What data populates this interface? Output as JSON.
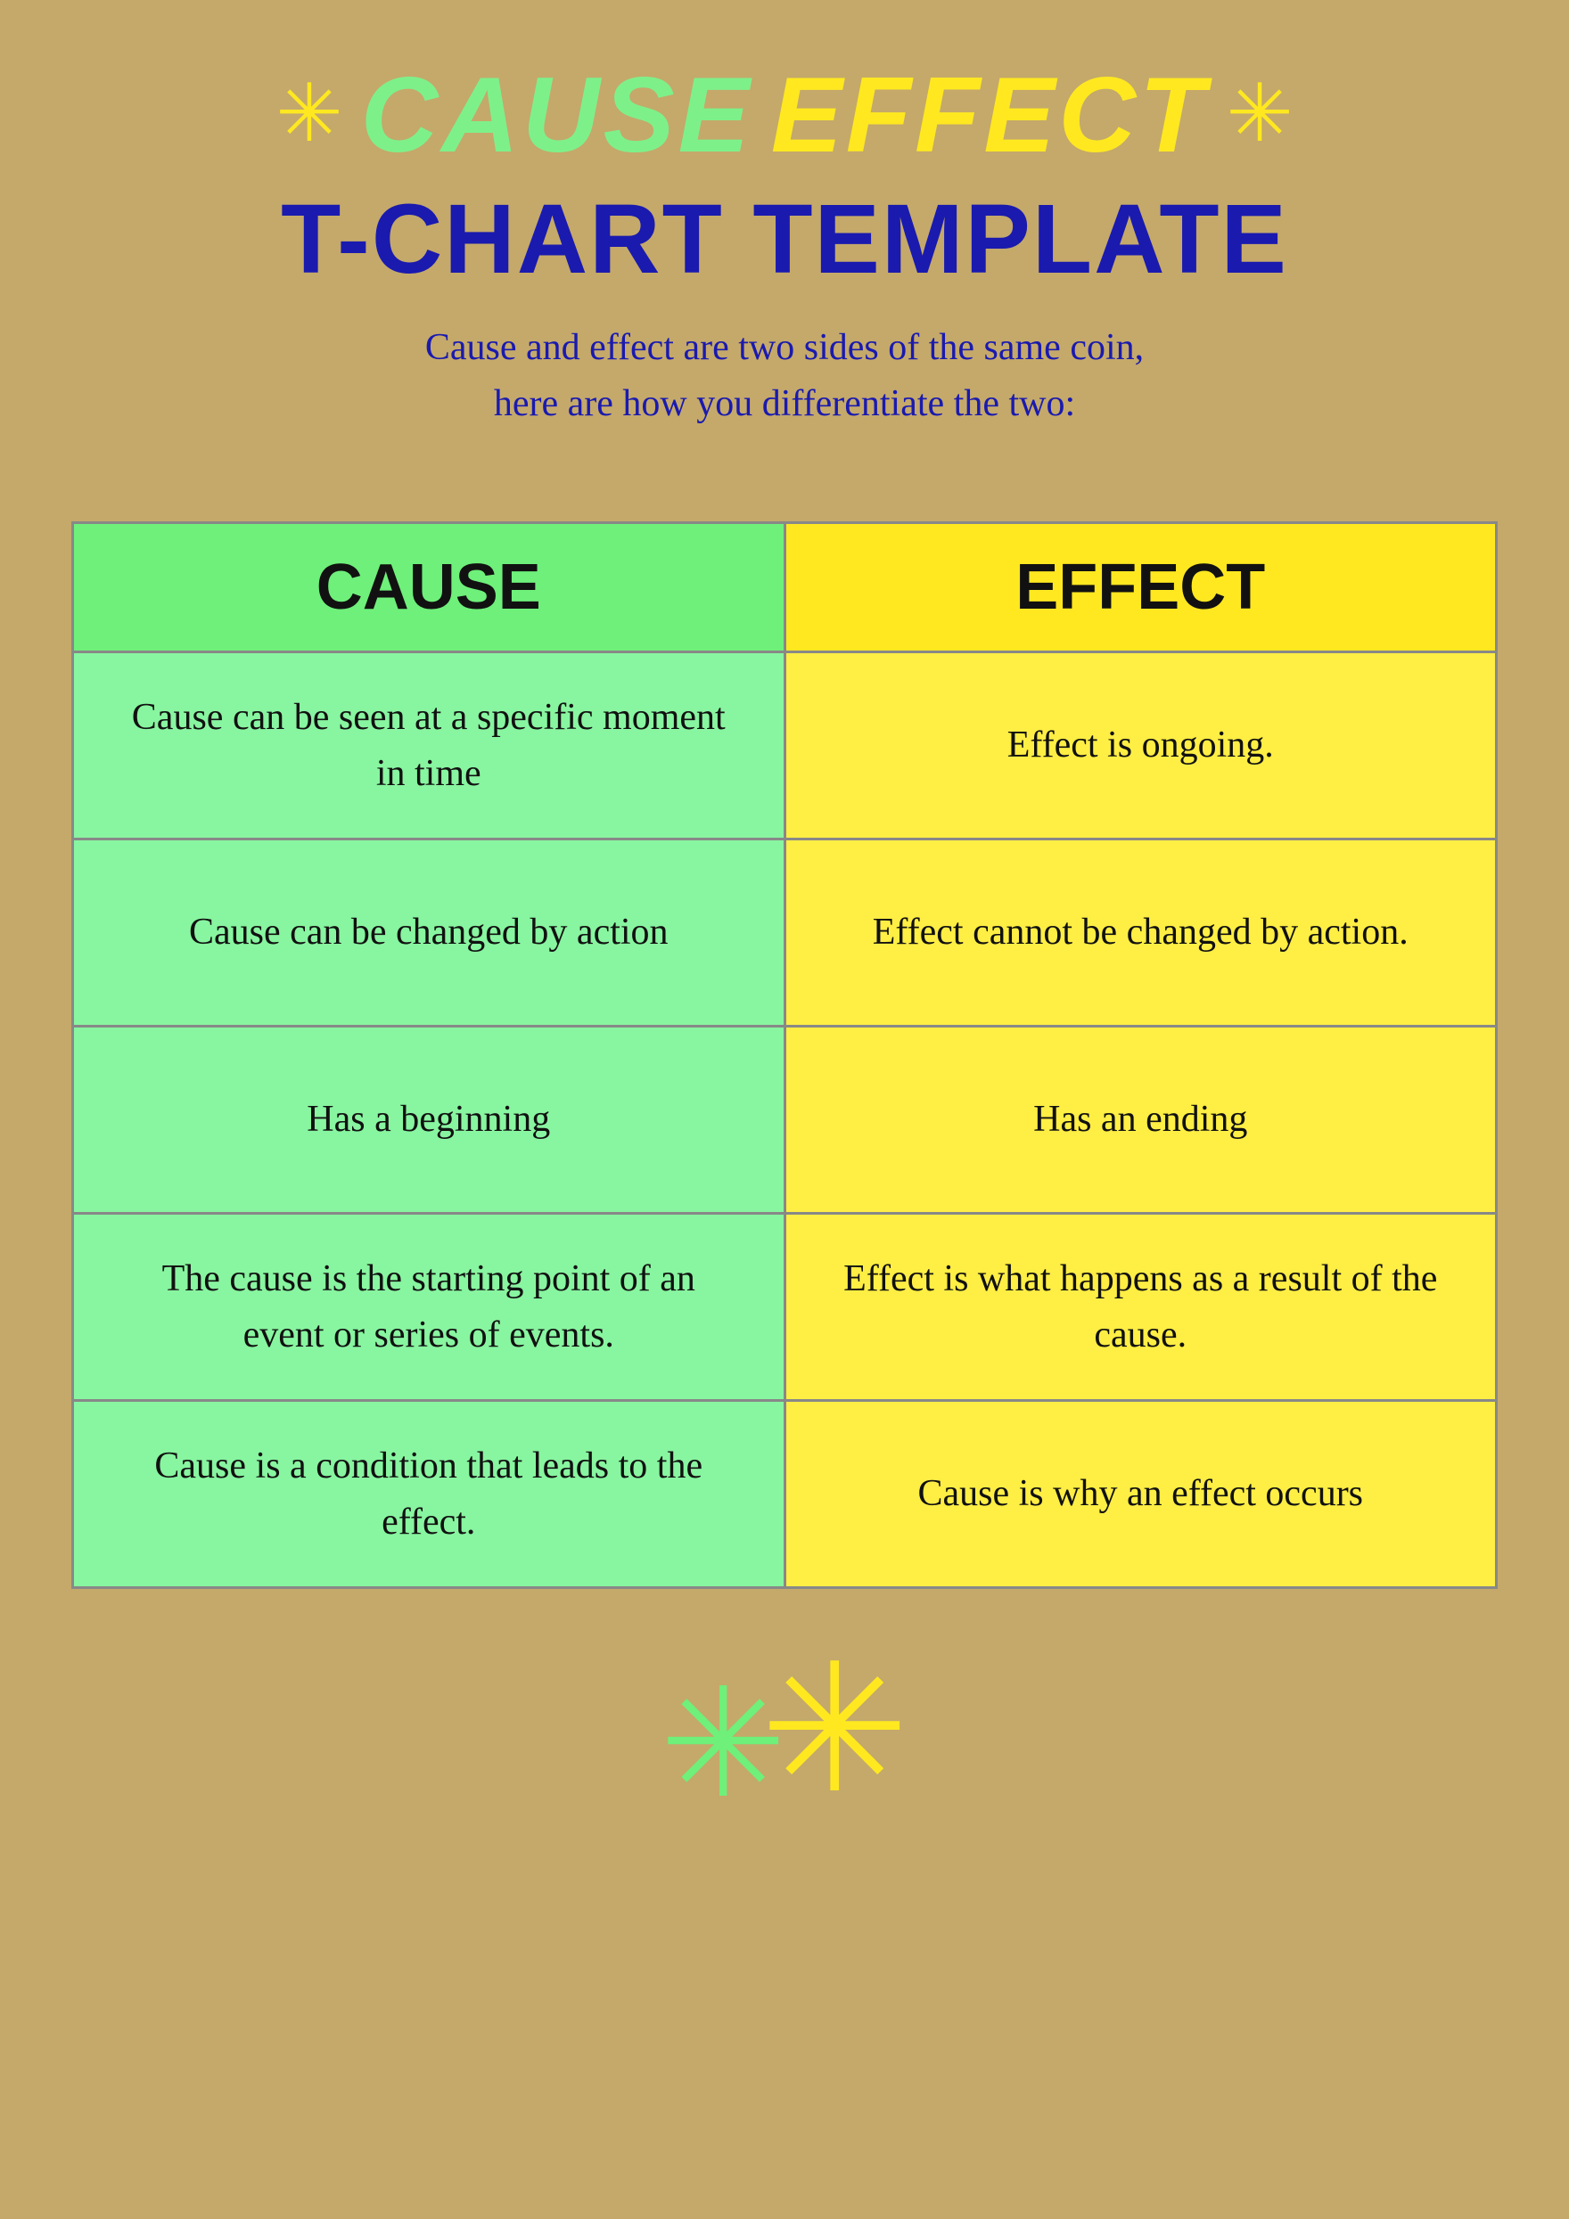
{
  "header": {
    "title_cause": "CAUSE",
    "title_effect": "EFFECT",
    "title_line2": "T-CHART TEMPLATE",
    "subtitle": "Cause and effect are two sides of the same coin,\nhere are how you differentiate the two:",
    "star_left": "✳",
    "star_right": "✳"
  },
  "chart": {
    "cause_header": "CAUSE",
    "effect_header": "EFFECT",
    "rows": [
      {
        "cause": "Cause can be seen at a specific moment in time",
        "effect": "Effect is ongoing."
      },
      {
        "cause": "Cause can be changed by action",
        "effect": "Effect cannot be changed by action."
      },
      {
        "cause": "Has a beginning",
        "effect": "Has an ending"
      },
      {
        "cause": "The cause is the starting point of an event or series of events.",
        "effect": "Effect is what happens as a result of the cause."
      },
      {
        "cause": "Cause is a condition that leads to the effect.",
        "effect": "Cause is why an effect occurs"
      }
    ]
  },
  "footer": {
    "deco_green": "❄",
    "deco_yellow": "❄"
  }
}
